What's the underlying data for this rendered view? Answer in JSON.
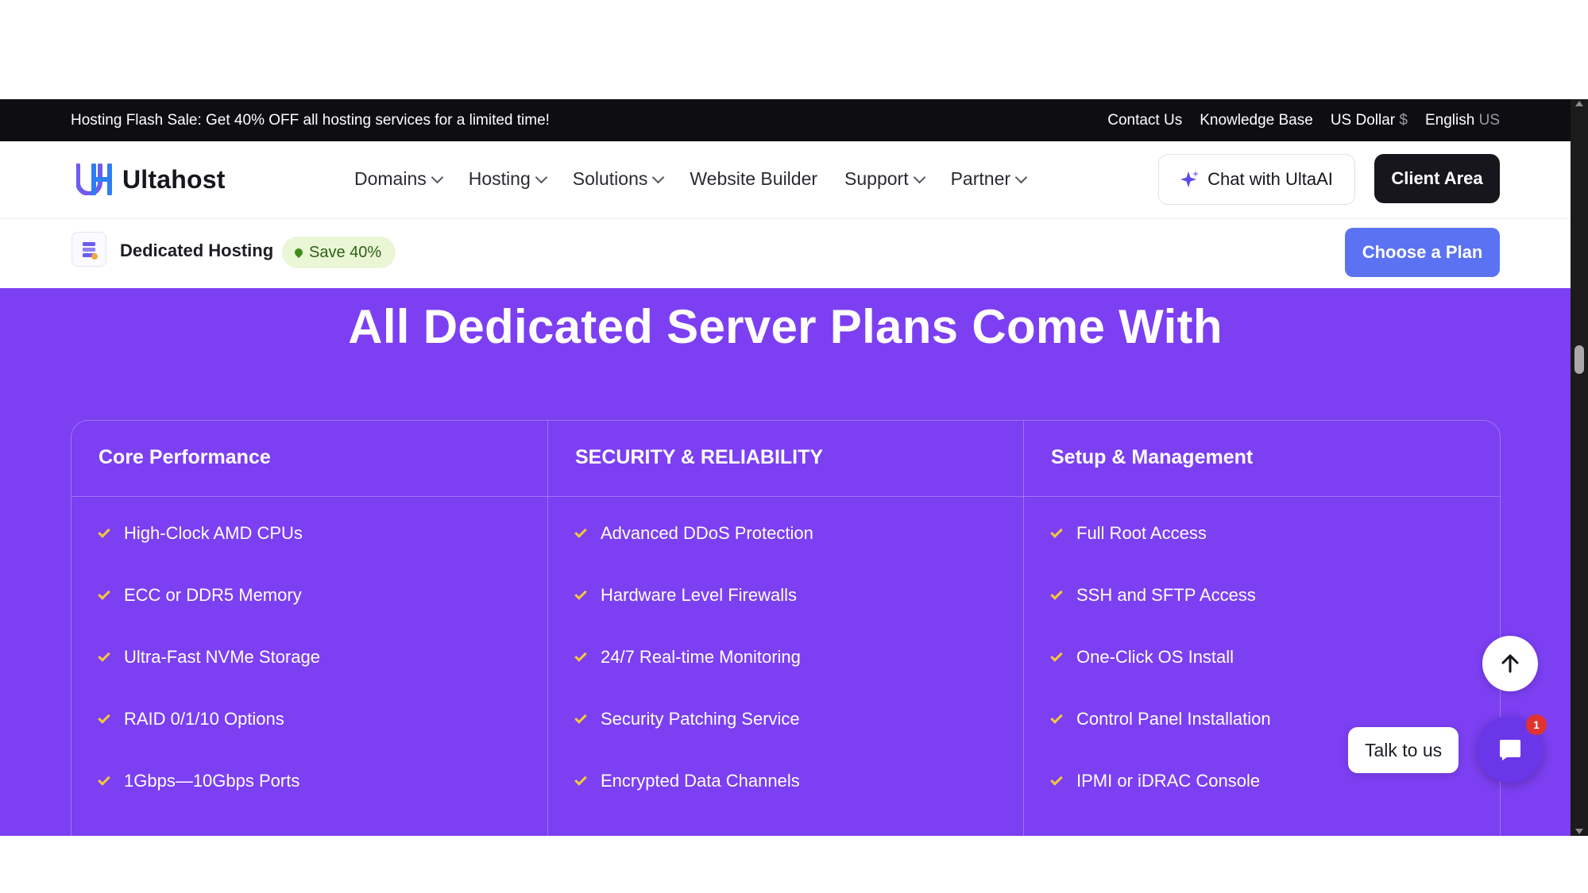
{
  "topbar": {
    "promo": "Hosting Flash Sale: Get 40% OFF all hosting services for a limited time!",
    "contact": "Contact Us",
    "knowledge": "Knowledge Base",
    "currency": "US Dollar",
    "currency_symbol": "$",
    "language": "English",
    "language_code": "US"
  },
  "nav": {
    "brand": "Ultahost",
    "items": [
      {
        "label": "Domains",
        "has_dropdown": true
      },
      {
        "label": "Hosting",
        "has_dropdown": true
      },
      {
        "label": "Solutions",
        "has_dropdown": true
      },
      {
        "label": "Website Builder",
        "has_dropdown": false
      },
      {
        "label": "Support",
        "has_dropdown": true
      },
      {
        "label": "Partner",
        "has_dropdown": true
      }
    ],
    "chat_label": "Chat with UltaAI",
    "client_label": "Client Area"
  },
  "subbar": {
    "title": "Dedicated Hosting",
    "badge": "Save 40%",
    "cta": "Choose a Plan"
  },
  "section": {
    "heading": "All Dedicated Server Plans Come With",
    "columns": [
      {
        "title": "Core Performance",
        "items": [
          "High-Clock AMD CPUs",
          "ECC or DDR5 Memory",
          "Ultra-Fast NVMe Storage",
          "RAID 0/1/10 Options",
          "1Gbps—10Gbps Ports"
        ]
      },
      {
        "title": "SECURITY & RELIABILITY",
        "items": [
          "Advanced DDoS Protection",
          "Hardware Level Firewalls",
          "24/7 Real-time Monitoring",
          "Security Patching Service",
          "Encrypted Data Channels"
        ]
      },
      {
        "title": "Setup & Management",
        "items": [
          "Full Root Access",
          "SSH and SFTP Access",
          "One-Click OS Install",
          "Control Panel Installation",
          "IPMI or iDRAC Console"
        ]
      }
    ]
  },
  "widgets": {
    "talk_label": "Talk to us",
    "notification_count": "1"
  },
  "colors": {
    "purple": "#7c3ff2",
    "check": "#f3c93a",
    "plan_button": "#5b73f2",
    "dark": "#0e0e12"
  }
}
